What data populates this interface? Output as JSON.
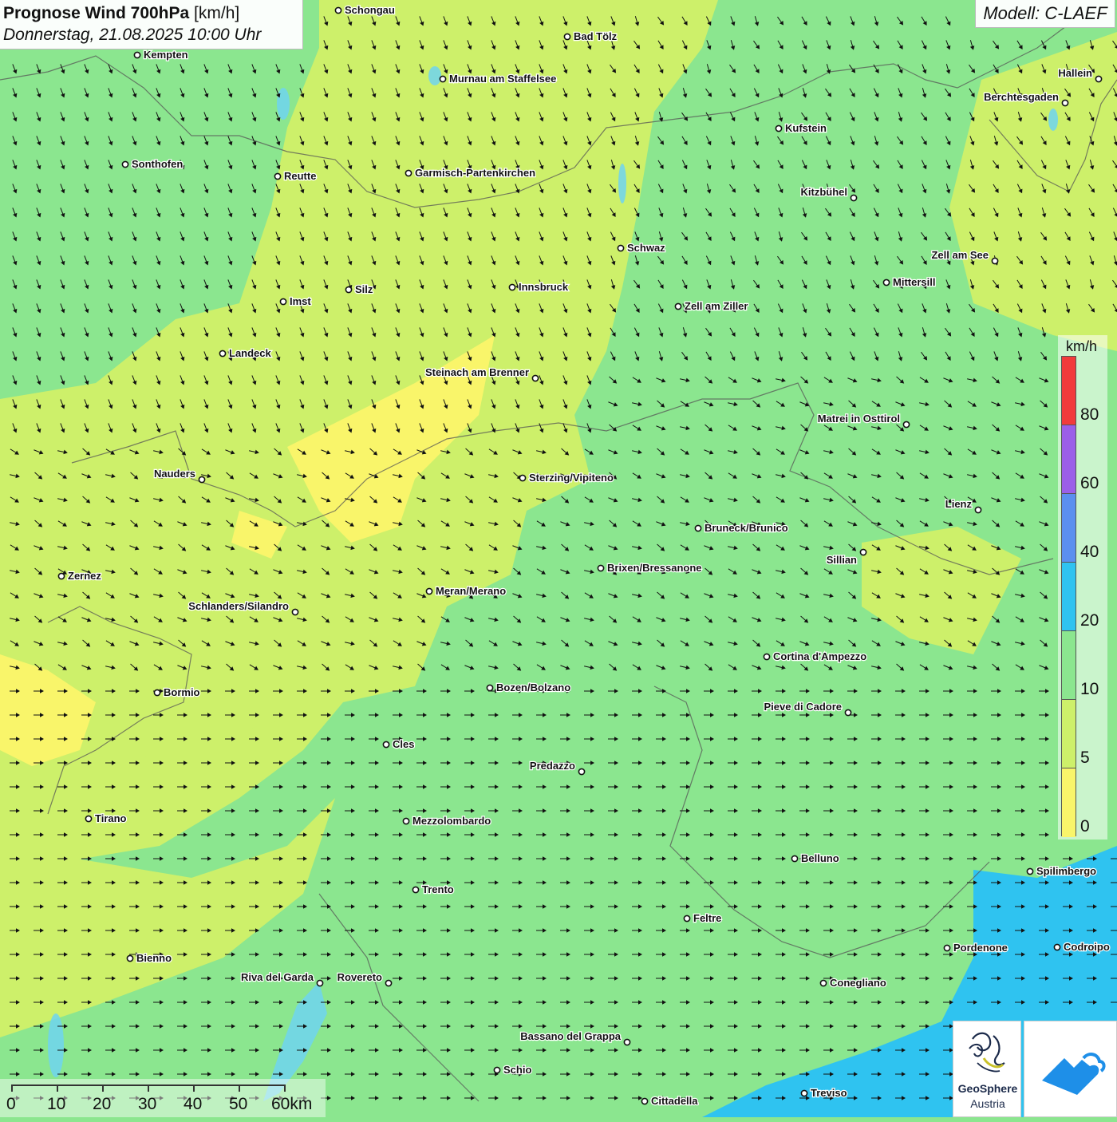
{
  "header": {
    "title_bold": "Prognose Wind 700hPa",
    "title_unit": "[km/h]",
    "datetime": "Donnerstag, 21.08.2025 10:00 Uhr"
  },
  "model_label": "Modell: C-LAEF",
  "legend": {
    "unit": "km/h",
    "ticks": [
      "80",
      "60",
      "40",
      "20",
      "10",
      "5",
      "0"
    ],
    "colors": [
      "#f13b3b",
      "#9b5fe8",
      "#5b8fef",
      "#2fc3f0",
      "#8be68f",
      "#cdf06a",
      "#f9f56a"
    ]
  },
  "scale_bar": {
    "labels": [
      "0",
      "10",
      "20",
      "30",
      "40",
      "50",
      "60km"
    ]
  },
  "cities": [
    {
      "name": "Schongau"
    },
    {
      "name": "Bad Tölz"
    },
    {
      "name": "Kempten"
    },
    {
      "name": "Murnau am Staffelsee"
    },
    {
      "name": "Hallein"
    },
    {
      "name": "Berchtesgaden"
    },
    {
      "name": "Kufstein"
    },
    {
      "name": "Sonthofen"
    },
    {
      "name": "Reutte"
    },
    {
      "name": "Garmisch-Partenkirchen"
    },
    {
      "name": "Kitzbühel"
    },
    {
      "name": "Schwaz"
    },
    {
      "name": "Zell am See"
    },
    {
      "name": "Mittersill"
    },
    {
      "name": "Imst"
    },
    {
      "name": "Silz"
    },
    {
      "name": "Innsbruck"
    },
    {
      "name": "Zell am Ziller"
    },
    {
      "name": "Landeck"
    },
    {
      "name": "Steinach am Brenner"
    },
    {
      "name": "Matrei in Osttirol"
    },
    {
      "name": "Nauders"
    },
    {
      "name": "Sterzing/Vipiteno"
    },
    {
      "name": "Lienz"
    },
    {
      "name": "Bruneck/Brunico"
    },
    {
      "name": "Sillian"
    },
    {
      "name": "Zernez"
    },
    {
      "name": "Brixen/Bressanone"
    },
    {
      "name": "Meran/Merano"
    },
    {
      "name": "Schlanders/Silandro"
    },
    {
      "name": "Cortina d'Ampezzo"
    },
    {
      "name": "Bozen/Bolzano"
    },
    {
      "name": "Bormio"
    },
    {
      "name": "Pieve di Cadore"
    },
    {
      "name": "Cles"
    },
    {
      "name": "Predazzo"
    },
    {
      "name": "Tirano"
    },
    {
      "name": "Mezzolombardo"
    },
    {
      "name": "Belluno"
    },
    {
      "name": "Spilimbergo"
    },
    {
      "name": "Trento"
    },
    {
      "name": "Feltre"
    },
    {
      "name": "Pordenone"
    },
    {
      "name": "Codroipo"
    },
    {
      "name": "Bienno"
    },
    {
      "name": "Riva del Garda"
    },
    {
      "name": "Rovereto"
    },
    {
      "name": "Conegliano"
    },
    {
      "name": "Bassano del Grappa"
    },
    {
      "name": "Schio"
    },
    {
      "name": "Treviso"
    },
    {
      "name": "Cittadella"
    }
  ],
  "logo": {
    "line1": "GeoSphere",
    "line2": "Austria"
  },
  "field_colors": {
    "calm": "#f9f56a",
    "light": "#cdf06a",
    "moderate": "#8be68f",
    "fresh": "#2fc3f0"
  }
}
